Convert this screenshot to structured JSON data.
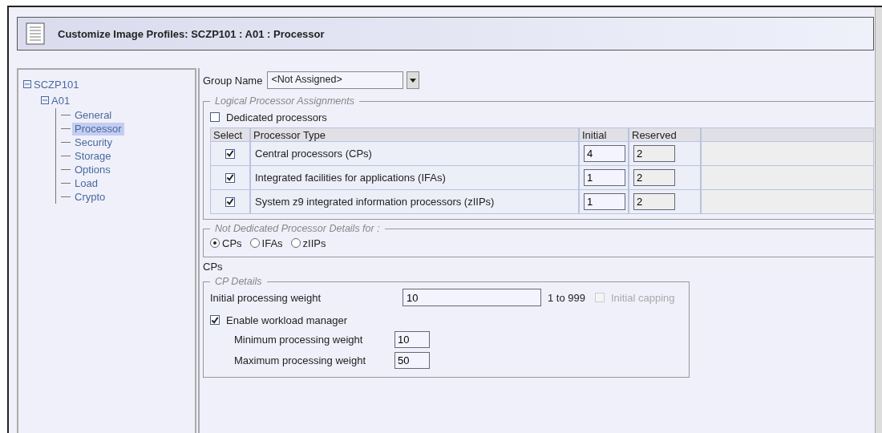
{
  "window": {
    "title": "Customize Image Profiles: SCZP101 : A01 : Processor"
  },
  "tree": [
    {
      "label": "SCZP101",
      "expanded": true,
      "children": [
        {
          "label": "A01",
          "expanded": true,
          "children": [
            {
              "label": "General",
              "selected": false
            },
            {
              "label": "Processor",
              "selected": true
            },
            {
              "label": "Security",
              "selected": false
            },
            {
              "label": "Storage",
              "selected": false
            },
            {
              "label": "Options",
              "selected": false
            },
            {
              "label": "Load",
              "selected": false
            },
            {
              "label": "Crypto",
              "selected": false
            }
          ]
        }
      ]
    }
  ],
  "group_name": {
    "label": "Group Name",
    "value": "<Not Assigned>"
  },
  "logical_assignments": {
    "legend": "Logical Processor Assignments",
    "dedicated": {
      "label": "Dedicated processors",
      "checked": false
    },
    "columns": [
      "Select",
      "Processor Type",
      "Initial",
      "Reserved"
    ],
    "rows": [
      {
        "checked": true,
        "type": "Central processors (CPs)",
        "initial": "4",
        "reserved": "2"
      },
      {
        "checked": true,
        "type": "Integrated facilities for applications (IFAs)",
        "initial": "1",
        "reserved": "2"
      },
      {
        "checked": true,
        "type": "System z9 integrated information processors (zIIPs)",
        "initial": "1",
        "reserved": "2"
      }
    ]
  },
  "not_dedicated": {
    "legend": "Not Dedicated Processor Details for :",
    "options": [
      {
        "label": "CPs",
        "selected": true
      },
      {
        "label": "IFAs",
        "selected": false
      },
      {
        "label": "zIIPs",
        "selected": false
      }
    ]
  },
  "section_label": "CPs",
  "cp_details": {
    "legend": "CP Details",
    "initial_weight": {
      "label": "Initial processing weight",
      "value": "10",
      "range": "1 to 999"
    },
    "initial_capping": {
      "label": "Initial capping",
      "checked": false,
      "disabled": true
    },
    "workload_manager": {
      "label": "Enable workload manager",
      "checked": true
    },
    "minimum": {
      "label": "Minimum processing weight",
      "value": "10"
    },
    "maximum": {
      "label": "Maximum processing weight",
      "value": "50"
    }
  }
}
